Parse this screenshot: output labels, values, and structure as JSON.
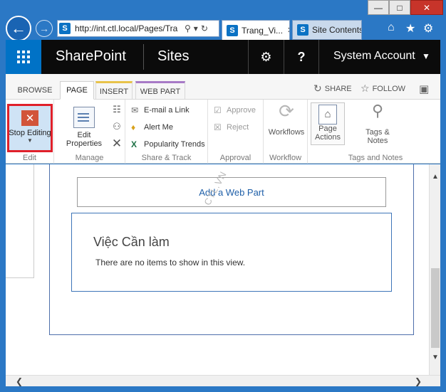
{
  "browser": {
    "address": "http://int.ctl.local/Pages/Tra",
    "tabs": [
      {
        "label": "Trang_Vi..."
      },
      {
        "label": "Site Contents"
      }
    ],
    "window_controls": {
      "minimize": "—",
      "maximize": "□",
      "close": "✕"
    }
  },
  "suite_bar": {
    "brand": "SharePoint",
    "section": "Sites",
    "user": "System Account"
  },
  "ribbon": {
    "tabs": [
      "BROWSE",
      "PAGE",
      "INSERT",
      "WEB PART"
    ],
    "actions": {
      "share": "SHARE",
      "follow": "FOLLOW"
    },
    "groups": {
      "edit": {
        "label": "Edit",
        "stop_editing": "Stop Editing"
      },
      "manage": {
        "label": "Manage",
        "edit_properties": "Edit Properties"
      },
      "share_track": {
        "label": "Share & Track",
        "email_link": "E-mail a Link",
        "alert_me": "Alert Me",
        "popularity": "Popularity Trends"
      },
      "approval": {
        "label": "Approval",
        "approve": "Approve",
        "reject": "Reject"
      },
      "workflow": {
        "label": "Workflow",
        "workflows": "Workflows"
      },
      "page_actions": {
        "label": "Page Actions"
      },
      "tags_notes": {
        "label": "Tags and Notes",
        "button": "Tags & Notes"
      }
    }
  },
  "content": {
    "add_web_part": "Add a Web Part",
    "webpart_title": "Việc Cần làm",
    "empty_message": "There are no items to show in this view.",
    "watermark": "CTL.VN"
  },
  "colors": {
    "chrome_blue": "#2b78c5",
    "suite_black": "#0b0b0b",
    "launcher_blue": "#0072c6",
    "highlight_red": "#e0202a"
  }
}
